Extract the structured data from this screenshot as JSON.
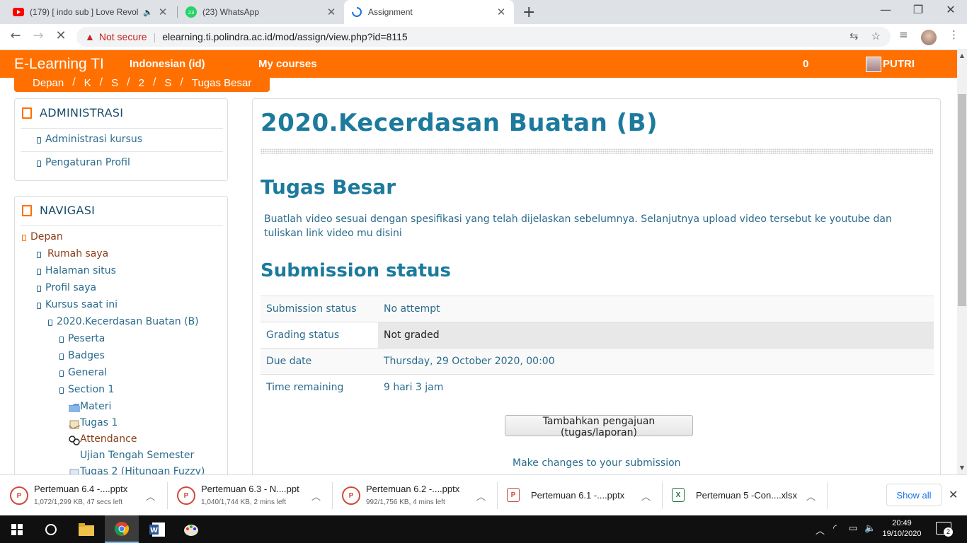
{
  "browser": {
    "tabs": [
      {
        "title": "(179) [ indo sub ] Love Revol",
        "favicon": "youtube-icon",
        "color": "#ff0000"
      },
      {
        "title": "(23) WhatsApp",
        "favicon": "whatsapp-icon",
        "color": "#25d366",
        "badge": "23"
      },
      {
        "title": "Assignment",
        "favicon": "loading-icon",
        "color": "#1a73e8"
      }
    ],
    "not_secure": "Not secure",
    "url": "elearning.ti.polindra.ac.id/mod/assign/view.php?id=8115"
  },
  "navbar": {
    "brand": "E-Learning TI",
    "language": "Indonesian (id) ",
    "my_courses": "My courses ",
    "notifications": "0 ",
    "messages": "",
    "user": "PUTRI "
  },
  "breadcrumb": [
    " Depan",
    "K",
    "S",
    "2",
    "S",
    "Tugas Besar"
  ],
  "admin_block": {
    "title": "ADMINISTRASI",
    "items": [
      "Administrasi kursus",
      "Pengaturan Profil"
    ]
  },
  "nav_block": {
    "title": "NAVIGASI",
    "depan": "Depan",
    "rumah": "Rumah saya",
    "halaman": "Halaman situs",
    "profil": "Profil saya",
    "kursus": "Kursus saat ini",
    "course": "2020.Kecerdasan Buatan (B)",
    "peserta": "Peserta",
    "badges": "Badges",
    "general": "General",
    "section1": "Section 1",
    "materi": "Materi",
    "tugas1": "Tugas 1",
    "attendance": "Attendance",
    "uts": "Ujian Tengah Semester",
    "tugas2": "Tugas 2 (Hitungan Fuzzy)"
  },
  "main": {
    "course_title": "2020.Kecerdasan Buatan (B)",
    "assignment_title": "Tugas Besar",
    "intro": "Buatlah video sesuai dengan spesifikasi yang telah dijelaskan sebelumnya. Selanjutnya upload video tersebut ke youtube dan tuliskan link video mu disini",
    "status_heading": "Submission status",
    "rows": [
      {
        "label": "Submission status",
        "value": "No attempt"
      },
      {
        "label": "Grading status",
        "value": "Not graded"
      },
      {
        "label": "Due date",
        "value": "Thursday, 29 October 2020, 00:00"
      },
      {
        "label": "Time remaining",
        "value": "9 hari 3 jam"
      }
    ],
    "button": "Tambahkan pengajuan (tugas/laporan)",
    "make_changes": "Make changes to your submission"
  },
  "downloads": [
    {
      "name": "Pertemuan 6.4 -....pptx",
      "meta": "1,072/1,299 KB, 47 secs left"
    },
    {
      "name": "Pertemuan 6.3 - N....ppt",
      "meta": "1,040/1,744 KB, 2 mins left"
    },
    {
      "name": "Pertemuan 6.2 -....pptx",
      "meta": "992/1,756 KB, 4 mins left"
    },
    {
      "name": "Pertemuan 6.1 -....pptx",
      "meta": ""
    },
    {
      "name": "Pertemuan 5 -Con....xlsx",
      "meta": ""
    }
  ],
  "show_all": "Show all",
  "taskbar": {
    "time": "20:49",
    "date": "19/10/2020",
    "notifications": "2"
  },
  "colors": {
    "brand": "#ff7000",
    "heading": "#1c7a9d",
    "link": "#2a6b8c"
  }
}
